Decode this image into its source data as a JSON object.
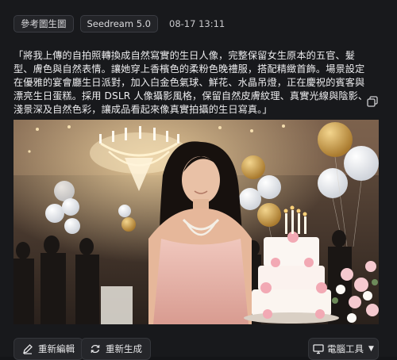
{
  "meta": {
    "tag_reference": "參考圖生圖",
    "tag_model": "Seedream 5.0",
    "timestamp": "08-17 13:11"
  },
  "prompt": {
    "text": "「將我上傳的自拍照轉換成自然寫實的生日人像，完整保留女生原本的五官、髮型、膚色與自然表情。讓她穿上香檳色的柔粉色晚禮服，搭配精緻首飾。場景設定在優雅的宴會廳生日派對，加入白金色氣球、鮮花、水晶吊燈，正在慶祝的賓客與漂亮生日蛋糕。採用 DSLR 人像攝影風格，保留自然皮膚紋理、真實光線與陰影、淺景深及自然色彩，讓成品看起來像真實拍攝的生日寫真。」"
  },
  "icons": {
    "copy": "copy-icon",
    "edit": "pencil-icon",
    "regenerate": "refresh-icon",
    "tools": "monitor-icon",
    "caret": "triangle-down-icon"
  },
  "actions": {
    "edit_label": "重新編輯",
    "regenerate_label": "重新生成",
    "tools_label": "電腦工具"
  },
  "colors": {
    "background": "#18191c",
    "chip_border": "#3a3c42",
    "button_bg": "#25262a"
  }
}
